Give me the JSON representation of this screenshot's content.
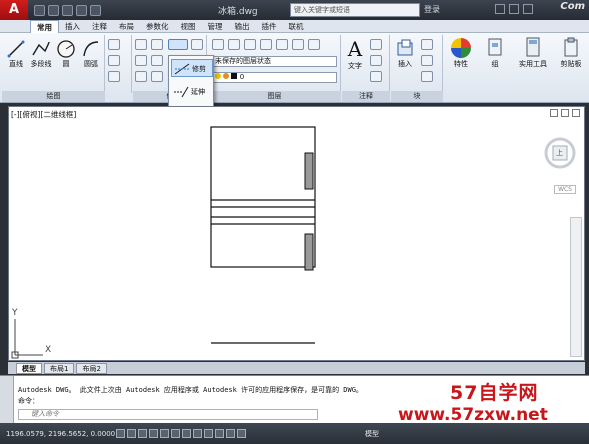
{
  "title": {
    "logo": "A",
    "file_name": "冰箱.dwg",
    "search_placeholder": "键入关键字或短语",
    "login": "登录",
    "watermark": "Com"
  },
  "tabs": [
    "常用",
    "插入",
    "注释",
    "布局",
    "参数化",
    "视图",
    "管理",
    "输出",
    "插件",
    "联机"
  ],
  "ribbon": {
    "draw_tools": [
      "直线",
      "多段线",
      "圆",
      "圆弧"
    ],
    "draw_group": "绘图",
    "modify_group": "修",
    "layer_state": "未保存的图层状态",
    "layer_group": "图层",
    "text_tool": "文字",
    "annotation_group": "注释",
    "insert_tool": "插入",
    "block_group": "块",
    "properties_tool": "特性",
    "group_tool": "组",
    "utilities_tool": "实用工具",
    "clipboard_tool": "剪贴板",
    "layer_number": "0"
  },
  "flyout": {
    "trim": "修剪",
    "extend": "延伸"
  },
  "viewport": {
    "label": "[-][俯视][二维线框]",
    "cube_label": "上",
    "wcs": "WCS",
    "axis_y": "Y",
    "axis_x": "X"
  },
  "layout_tabs": [
    "模型",
    "布局1",
    "布局2"
  ],
  "command": {
    "line1": "Autodesk DWG。  此文件上次由 Autodesk 应用程序或 Autodesk 许可的应用程序保存，是可靠的 DWG。",
    "line2": "命令：",
    "input_placeholder": "键入命令"
  },
  "watermark": {
    "name": "57自学网",
    "url": "www.57zxw.net"
  },
  "status": {
    "coords": "1196.0579, 2196.5652, 0.0000",
    "model": "模型"
  }
}
